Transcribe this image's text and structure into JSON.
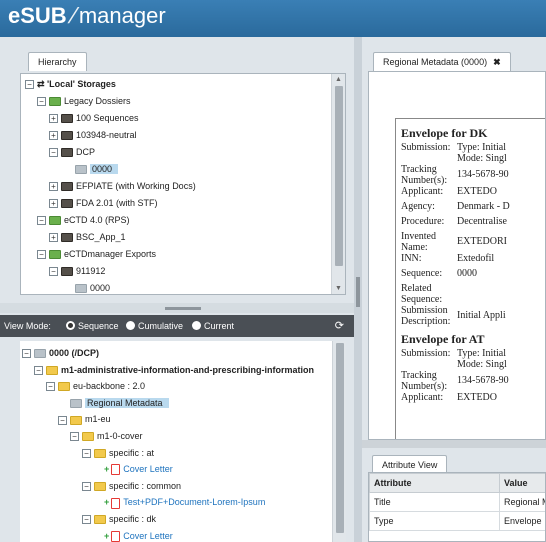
{
  "app": {
    "brand_bold": "eSUB",
    "brand_light": "manager"
  },
  "left_tab": "Hierarchy",
  "hierarchy": [
    {
      "label": "'Local' Storages",
      "toggle": "⊟",
      "icon": "swap",
      "bold": true
    },
    {
      "label": "Legacy Dossiers",
      "toggle": "⊟",
      "icon": "green"
    },
    {
      "label": "100 Sequences",
      "toggle": "⊞",
      "icon": "dark"
    },
    {
      "label": "103948-neutral",
      "toggle": "⊞",
      "icon": "dark"
    },
    {
      "label": "DCP",
      "toggle": "⊟",
      "icon": "dark"
    },
    {
      "label": "0000",
      "toggle": "",
      "icon": "grey",
      "selected": true
    },
    {
      "label": "EFPIATE (with Working Docs)",
      "toggle": "⊞",
      "icon": "dark"
    },
    {
      "label": "FDA 2.01 (with STF)",
      "toggle": "⊞",
      "icon": "dark"
    },
    {
      "label": "eCTD 4.0 (RPS)",
      "toggle": "⊟",
      "icon": "green"
    },
    {
      "label": "BSC_App_1",
      "toggle": "⊞",
      "icon": "dark"
    },
    {
      "label": "eCTDmanager Exports",
      "toggle": "⊟",
      "icon": "green"
    },
    {
      "label": "911912",
      "toggle": "⊟",
      "icon": "dark"
    },
    {
      "label": "0000",
      "toggle": "",
      "icon": "grey"
    }
  ],
  "view_mode": {
    "label": "View Mode:",
    "options": [
      "Sequence",
      "Cumulative",
      "Current"
    ],
    "selected": "Sequence",
    "refresh_icon": "refresh-icon"
  },
  "sequence_tree": [
    {
      "label": "0000 (/DCP)",
      "toggle": "⊟",
      "icon": "grey",
      "bold": true
    },
    {
      "label": "m1-administrative-information-and-prescribing-information",
      "toggle": "⊟",
      "icon": "folder",
      "bold": true
    },
    {
      "label": "eu-backbone : 2.0",
      "toggle": "⊟",
      "icon": "folder"
    },
    {
      "label": "Regional Metadata",
      "toggle": "",
      "icon": "grey",
      "selected": true
    },
    {
      "label": "m1-eu",
      "toggle": "⊟",
      "icon": "folder"
    },
    {
      "label": "m1-0-cover",
      "toggle": "⊟",
      "icon": "folder"
    },
    {
      "label": "specific : at",
      "toggle": "⊟",
      "icon": "folder"
    },
    {
      "label": "Cover Letter",
      "toggle": "",
      "icon": "doc",
      "plus": true,
      "link": true
    },
    {
      "label": "specific : common",
      "toggle": "⊟",
      "icon": "folder"
    },
    {
      "label": "Test+PDF+Document-Lorem-Ipsum",
      "toggle": "",
      "icon": "doc",
      "plus": true,
      "link": true
    },
    {
      "label": "specific : dk",
      "toggle": "⊟",
      "icon": "folder"
    },
    {
      "label": "Cover Letter",
      "toggle": "",
      "icon": "doc",
      "plus": true,
      "link": true
    }
  ],
  "right_tab": "Regional Metadata (0000)",
  "envelope_dk": {
    "heading": "Envelope for DK",
    "rows": [
      {
        "k": "Submission:",
        "v": "Type: Initial\nMode: Singl"
      },
      {
        "k": "Tracking Number(s):",
        "v": "134-5678-90"
      },
      {
        "k": "Applicant:",
        "v": "EXTEDO"
      },
      {
        "k": "Agency:",
        "v": "Denmark - D"
      },
      {
        "k": "Procedure:",
        "v": "Decentralise"
      },
      {
        "k": "Invented Name:",
        "v": "EXTEDORI"
      },
      {
        "k": "INN:",
        "v": "Extedofil"
      },
      {
        "k": "Sequence:",
        "v": "0000"
      },
      {
        "k": "Related Sequence:",
        "v": ""
      },
      {
        "k": "Submission Description:",
        "v": "Initial Appli"
      }
    ]
  },
  "envelope_at": {
    "heading": "Envelope for AT",
    "rows": [
      {
        "k": "Submission:",
        "v": "Type: Initial\nMode: Singl"
      },
      {
        "k": "Tracking Number(s):",
        "v": "134-5678-90"
      },
      {
        "k": "Applicant:",
        "v": "EXTEDO"
      }
    ]
  },
  "attr_tab": "Attribute View",
  "attr_table": {
    "headers": [
      "Attribute",
      "Value"
    ],
    "rows": [
      [
        "Title",
        "Regional M"
      ],
      [
        "Type",
        "Envelope"
      ]
    ]
  }
}
